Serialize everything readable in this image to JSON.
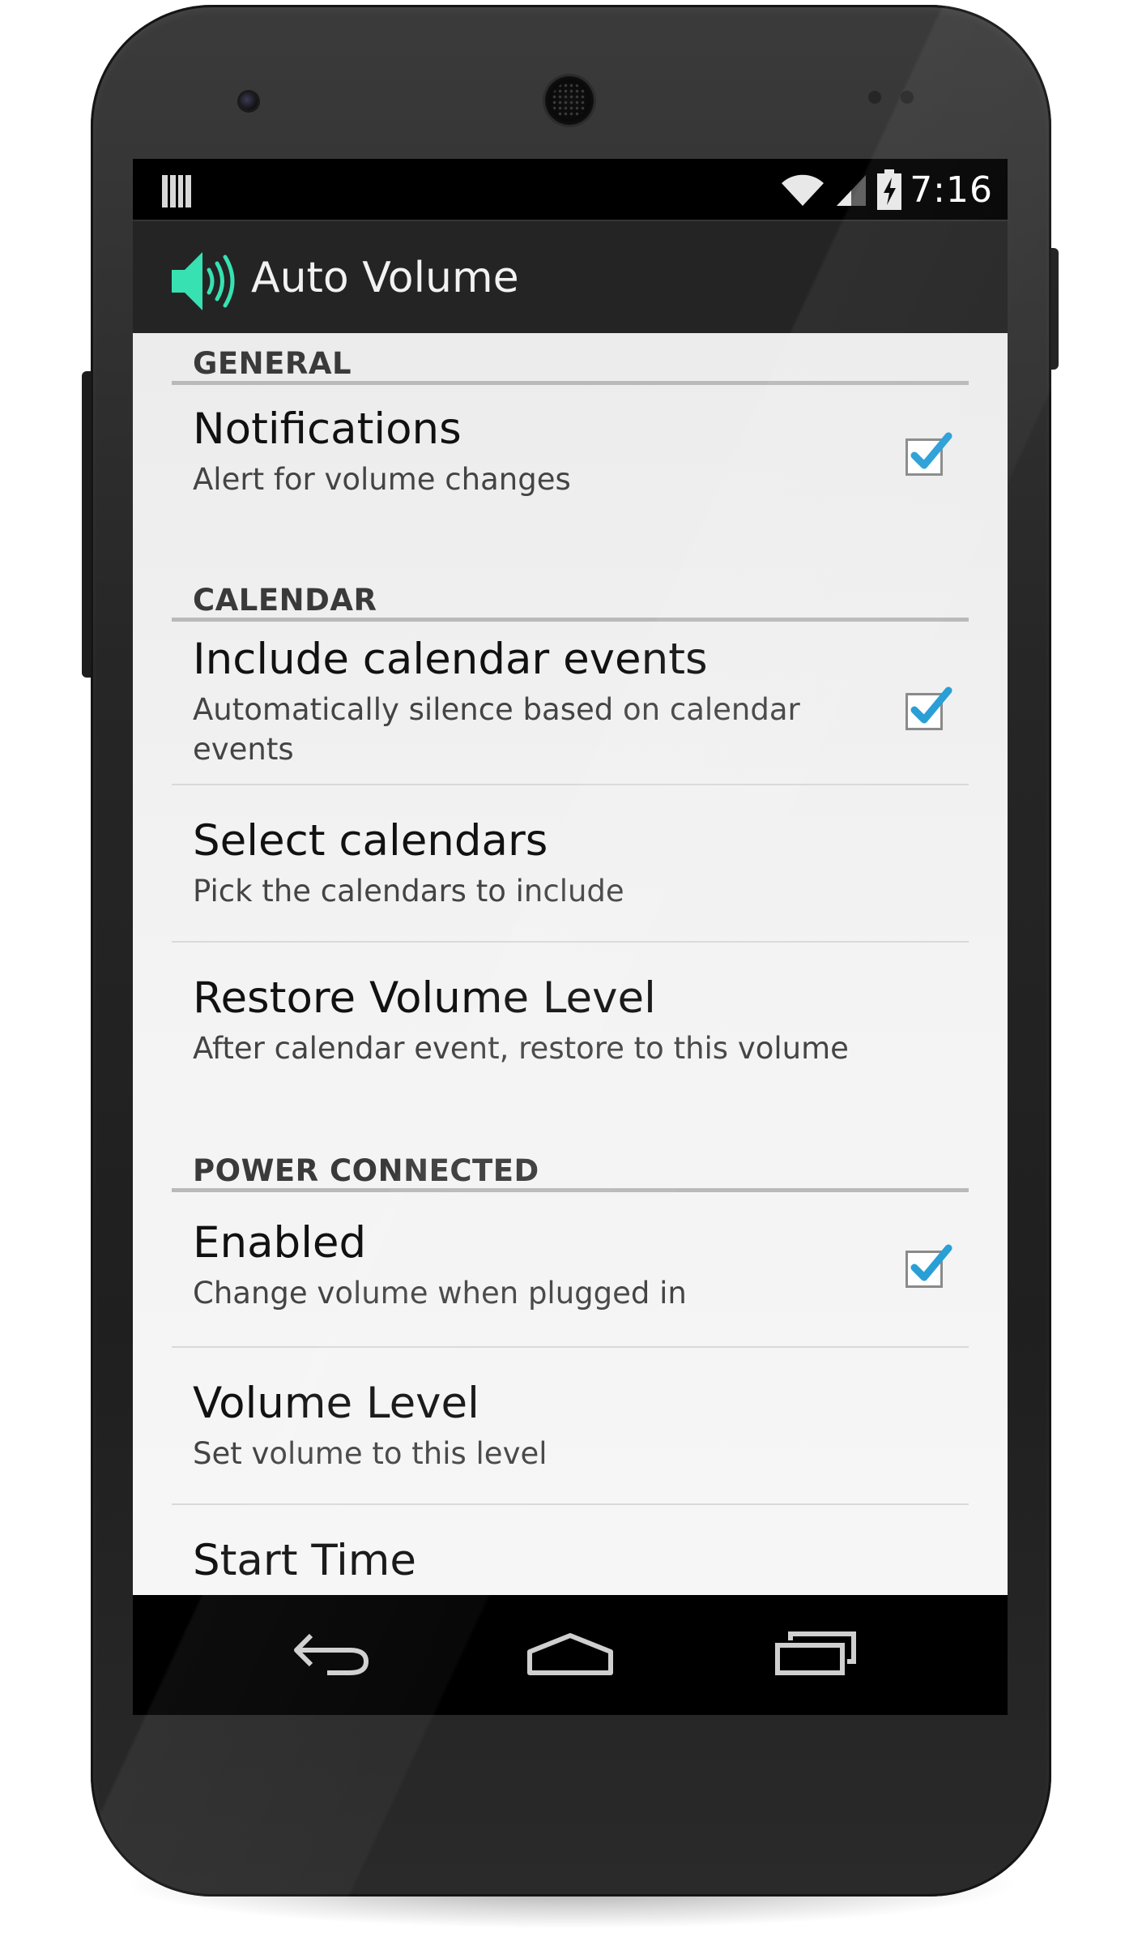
{
  "status_bar": {
    "time": "7:16",
    "icons": [
      "notification-bars-icon",
      "wifi-icon",
      "signal-icon",
      "battery-charging-icon"
    ]
  },
  "action_bar": {
    "app_icon": "speaker-volume-icon",
    "title": "Auto Volume",
    "accent_color": "#37e1b2"
  },
  "sections": {
    "general": {
      "label": "GENERAL",
      "notifications": {
        "title": "Notifications",
        "summary": "Alert for volume changes",
        "checked": true
      }
    },
    "calendar": {
      "label": "CALENDAR",
      "include_events": {
        "title": "Include calendar events",
        "summary": "Automatically silence based on calendar events",
        "checked": true
      },
      "select_calendars": {
        "title": "Select calendars",
        "summary": "Pick the calendars to include"
      },
      "restore_volume": {
        "title": "Restore Volume Level",
        "summary": "After calendar event, restore to this volume"
      }
    },
    "power_connected": {
      "label": "POWER CONNECTED",
      "enabled": {
        "title": "Enabled",
        "summary": "Change volume when plugged in",
        "checked": true
      },
      "volume_level": {
        "title": "Volume Level",
        "summary": "Set volume to this level"
      },
      "start_time": {
        "title": "Start Time"
      }
    }
  },
  "colors": {
    "checkmark": "#2a9fd6",
    "section_divider": "#b9b9b9"
  },
  "nav_bar": {
    "icons": [
      "back-icon",
      "home-icon",
      "recent-apps-icon"
    ]
  }
}
